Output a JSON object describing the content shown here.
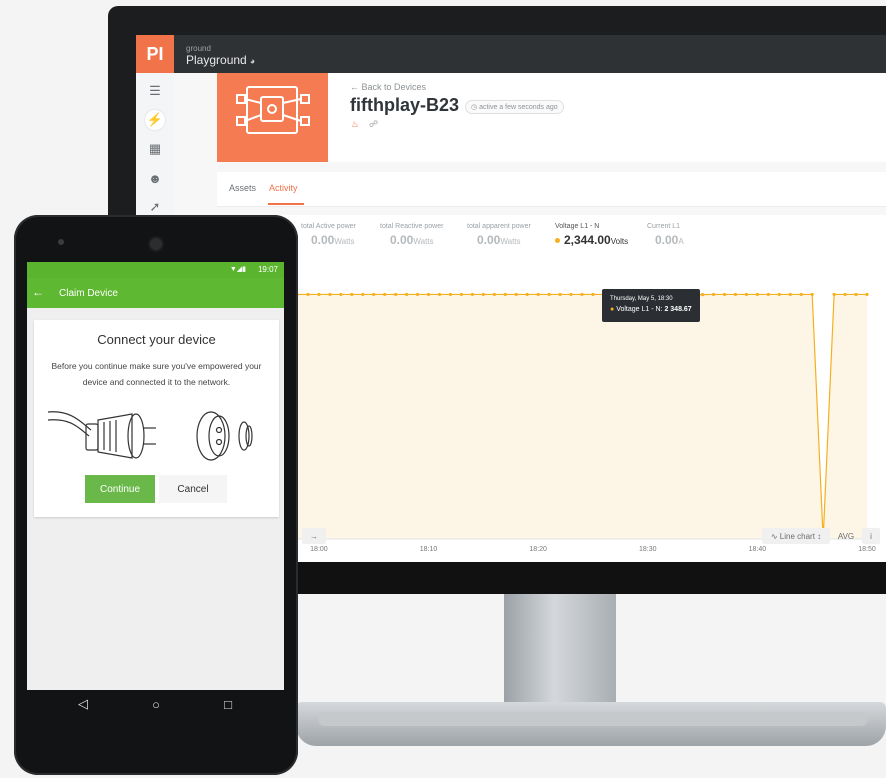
{
  "monitor_app": {
    "org_sub": "ground",
    "org_name": "Playground",
    "logo": "PI",
    "sidenav_icons": [
      "menu-icon",
      "plug-icon",
      "devices-icon",
      "user-icon",
      "bolt-icon"
    ],
    "back_link": "Back to Devices",
    "device_name": "fifthplay-B23",
    "active_badge": "active a few seconds ago",
    "tabs": [
      {
        "label": "Assets"
      },
      {
        "label": "Activity"
      }
    ],
    "active_tab": "Activity",
    "metrics": [
      {
        "label": "total Active power",
        "value": "0.00",
        "unit": "Watts"
      },
      {
        "label": "total Reactive power",
        "value": "0.00",
        "unit": "Watts"
      },
      {
        "label": "total apparent power",
        "value": "0.00",
        "unit": "Watts"
      },
      {
        "label": "Voltage L1 - N",
        "value": "2,344.00",
        "unit": "Volts"
      },
      {
        "label": "Current L1",
        "value": "0.00",
        "unit": "A"
      }
    ],
    "tooltip": {
      "date": "Thursday, May 5, 18:30",
      "series": "Voltage L1 - N:",
      "value": "2 348.67"
    },
    "chart_controls": {
      "line_chart": "Line chart",
      "avg": "AVG",
      "info": "i"
    },
    "accent": "#f0734a"
  },
  "chart_data": {
    "type": "line",
    "x_ticks": [
      "18:00",
      "18:10",
      "18:20",
      "18:30",
      "18:40",
      "18:50"
    ],
    "series": [
      {
        "name": "Voltage L1 - N",
        "color": "#f5b020",
        "x": [
          "17:58",
          "17:59",
          "18:00",
          "18:01",
          "18:02",
          "18:03",
          "18:04",
          "18:05",
          "18:06",
          "18:07",
          "18:08",
          "18:09",
          "18:10",
          "18:11",
          "18:12",
          "18:13",
          "18:14",
          "18:15",
          "18:16",
          "18:17",
          "18:18",
          "18:19",
          "18:20",
          "18:21",
          "18:22",
          "18:23",
          "18:24",
          "18:25",
          "18:26",
          "18:27",
          "18:28",
          "18:29",
          "18:30",
          "18:31",
          "18:32",
          "18:33",
          "18:34",
          "18:35",
          "18:36",
          "18:37",
          "18:38",
          "18:39",
          "18:40",
          "18:41",
          "18:42",
          "18:43",
          "18:44",
          "18:45",
          "18:46",
          "18:47",
          "18:48",
          "18:49",
          "18:50"
        ],
        "values": [
          2348,
          2348,
          2348,
          2348,
          2348,
          2348,
          2348,
          2348,
          2348,
          2348,
          2348,
          2348,
          2348,
          2348,
          2348,
          2348,
          2348,
          2348,
          2348,
          2348,
          2348,
          2348,
          2348,
          2348,
          2348,
          2348,
          2348,
          2348,
          2348,
          2348,
          2348,
          2348,
          2348.67,
          2347,
          2340,
          2345,
          2342,
          2346,
          2348,
          2348,
          2348,
          2348,
          2348,
          2348,
          2348,
          2348,
          2348,
          2348,
          0,
          2348,
          2348,
          2348,
          2348
        ]
      }
    ]
  },
  "phone": {
    "time": "19:07",
    "appbar_title": "Claim Device",
    "card_title": "Connect your device",
    "card_text": "Before you continue make sure you've empowered your device and connected it to the network.",
    "continue": "Continue",
    "cancel": "Cancel",
    "accent": "#5fb832"
  }
}
